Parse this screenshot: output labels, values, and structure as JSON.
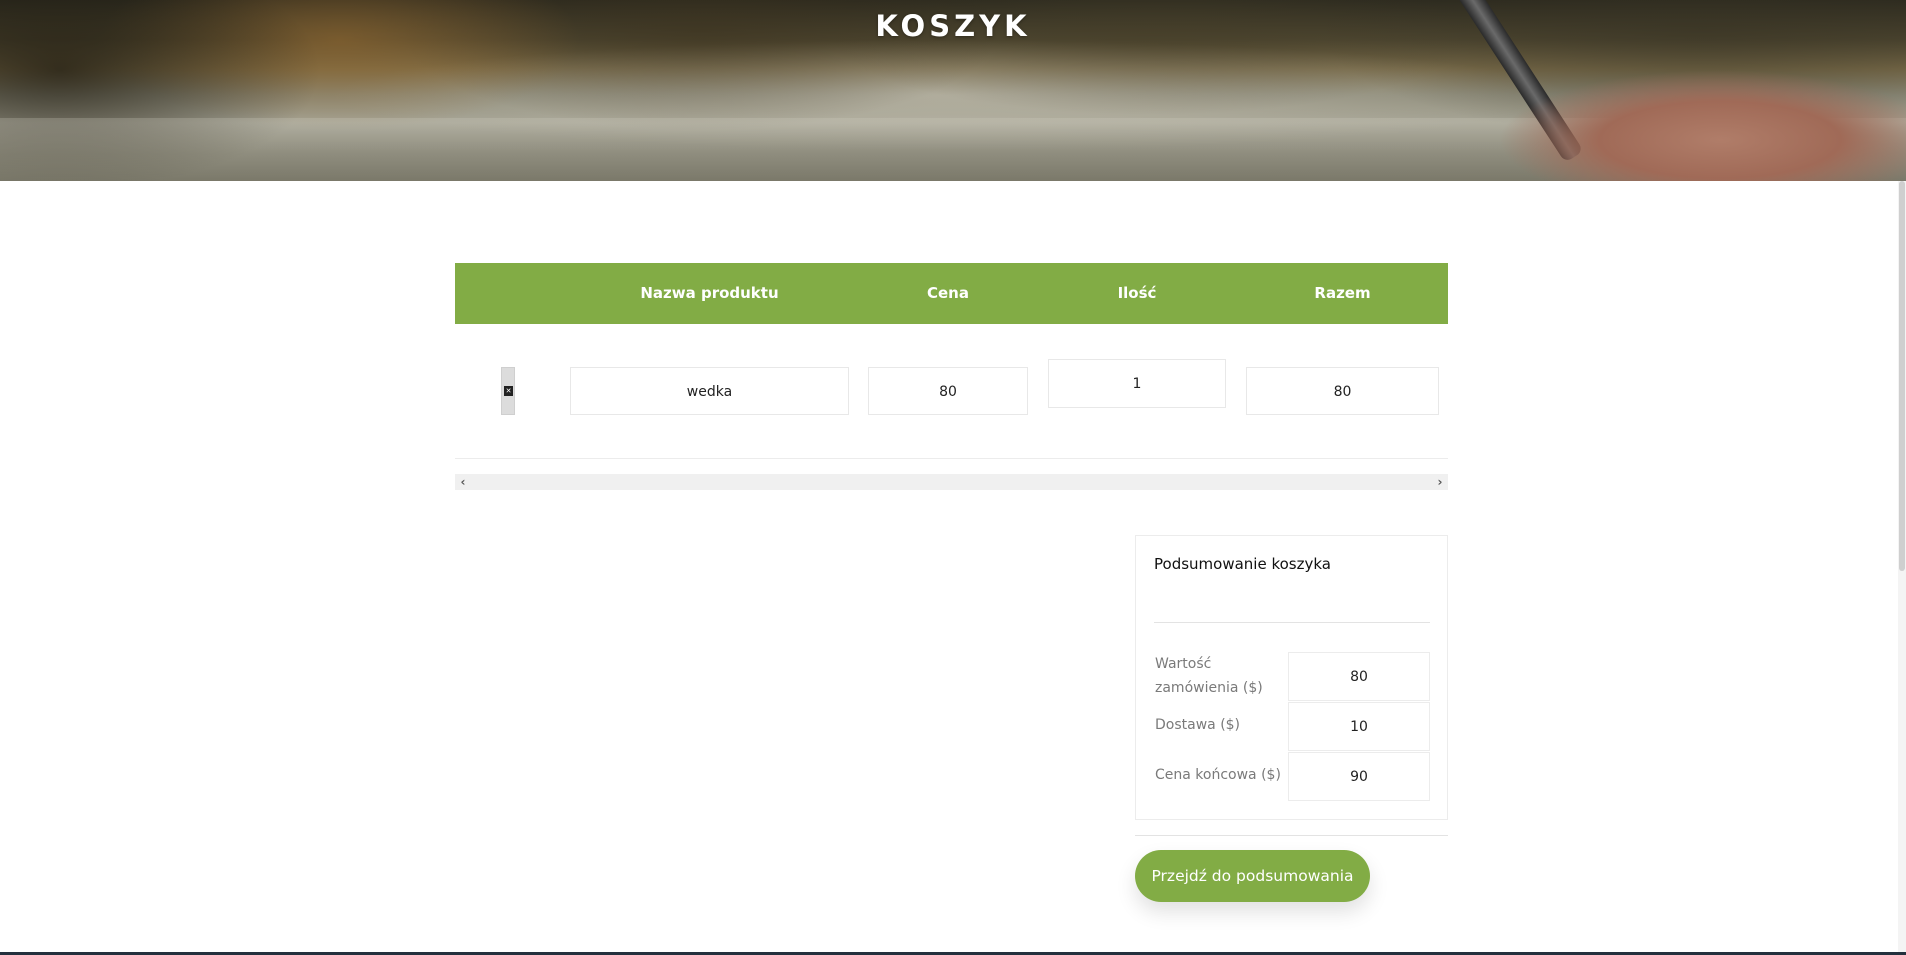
{
  "hero": {
    "title": "KOSZYK"
  },
  "cart_table": {
    "headers": [
      "",
      "Nazwa produktu",
      "Cena",
      "Ilość",
      "Razem"
    ],
    "rows": [
      {
        "remove_icon": "remove-item-icon",
        "name": "wedka",
        "price": "80",
        "quantity": "1",
        "total": "80"
      }
    ]
  },
  "scrollbar": {
    "left_arrow": "‹",
    "right_arrow": "›"
  },
  "summary": {
    "title": "Podsumowanie koszyka",
    "rows": [
      {
        "label": "Wartość zamówienia ($)",
        "value": "80"
      },
      {
        "label": "Dostawa ($)",
        "value": "10"
      },
      {
        "label": "Cena końcowa ($)",
        "value": "90"
      }
    ]
  },
  "checkout_button": {
    "label": "Przejdź do podsumowania"
  },
  "colors": {
    "accent": "#82ac45",
    "footer": "#23303d"
  }
}
